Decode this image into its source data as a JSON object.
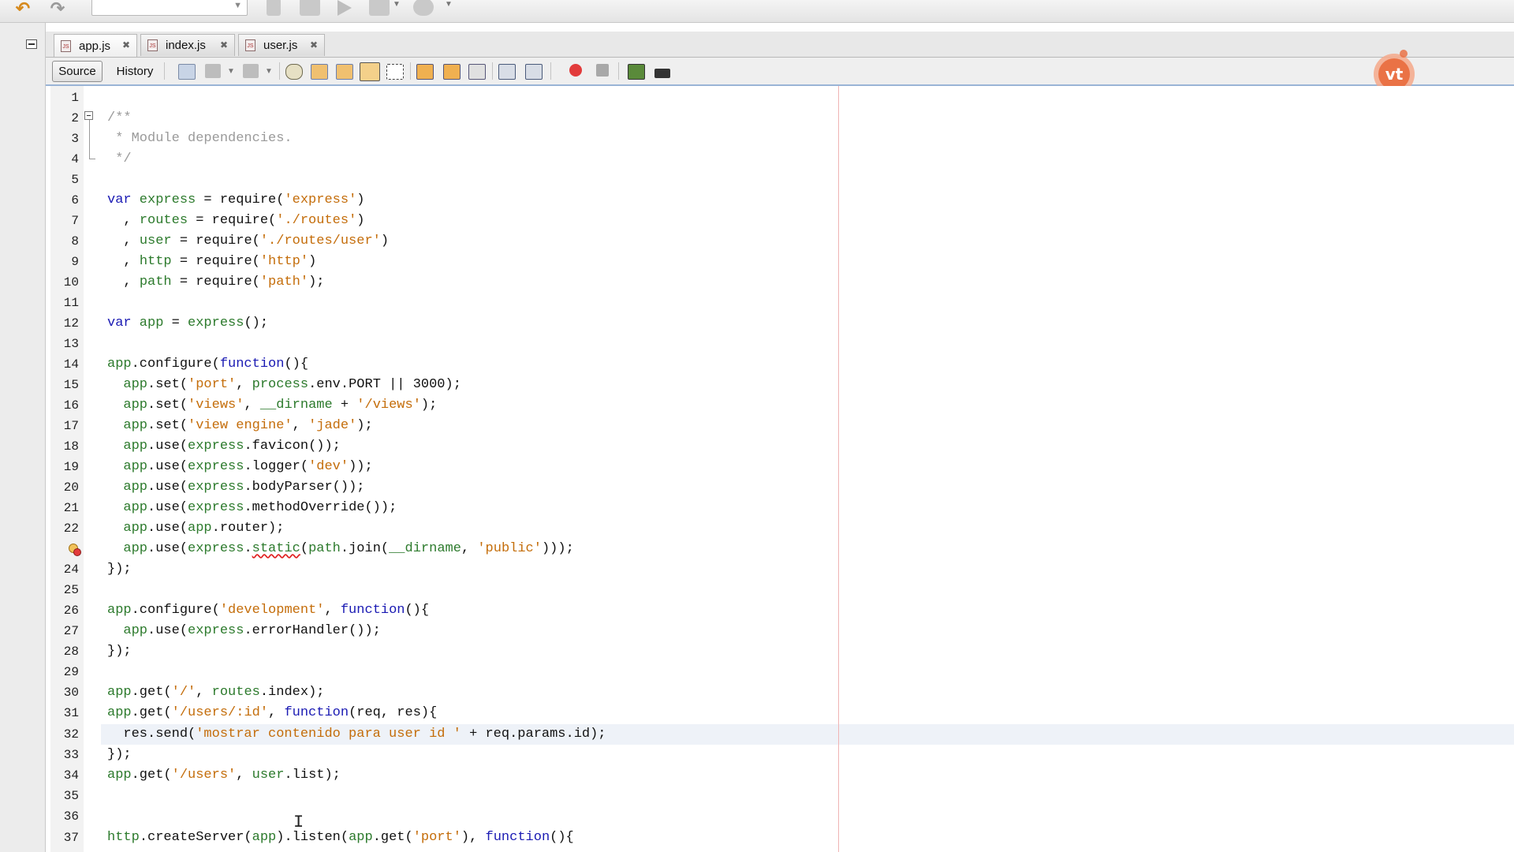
{
  "tabs": [
    {
      "label": "app.js",
      "active": true
    },
    {
      "label": "index.js",
      "active": false
    },
    {
      "label": "user.js",
      "active": false
    }
  ],
  "editor_toolbar": {
    "source_label": "Source",
    "history_label": "History"
  },
  "line_numbers": [
    "1",
    "2",
    "3",
    "4",
    "5",
    "6",
    "7",
    "8",
    "9",
    "10",
    "11",
    "12",
    "13",
    "14",
    "15",
    "16",
    "17",
    "18",
    "19",
    "20",
    "21",
    "22",
    "",
    "24",
    "25",
    "26",
    "27",
    "28",
    "29",
    "30",
    "31",
    "32",
    "33",
    "34",
    "35",
    "36",
    "37"
  ],
  "code": {
    "l2": "/**",
    "l3": " * Module dependencies.",
    "l4": " */",
    "l6a": "var",
    "l6b": " express",
    "l6c": " = require(",
    "l6d": "'express'",
    "l6e": ")",
    "l7a": "  , ",
    "l7b": "routes",
    "l7c": " = require(",
    "l7d": "'./routes'",
    "l7e": ")",
    "l8a": "  , ",
    "l8b": "user",
    "l8c": " = require(",
    "l8d": "'./routes/user'",
    "l8e": ")",
    "l9a": "  , ",
    "l9b": "http",
    "l9c": " = require(",
    "l9d": "'http'",
    "l9e": ")",
    "l10a": "  , ",
    "l10b": "path",
    "l10c": " = require(",
    "l10d": "'path'",
    "l10e": ");",
    "l12a": "var",
    "l12b": " app",
    "l12c": " = ",
    "l12d": "express",
    "l12e": "();",
    "l14a": "app",
    "l14b": ".configure(",
    "l14c": "function",
    "l14d": "(){",
    "l15a": "  app",
    "l15b": ".set(",
    "l15c": "'port'",
    "l15d": ", ",
    "l15e": "process",
    "l15f": ".env.PORT || 3000);",
    "l16a": "  app",
    "l16b": ".set(",
    "l16c": "'views'",
    "l16d": ", ",
    "l16e": "__dirname",
    "l16f": " + ",
    "l16g": "'/views'",
    "l16h": ");",
    "l17a": "  app",
    "l17b": ".set(",
    "l17c": "'view engine'",
    "l17d": ", ",
    "l17e": "'jade'",
    "l17f": ");",
    "l18a": "  app",
    "l18b": ".use(",
    "l18c": "express",
    "l18d": ".favicon());",
    "l19a": "  app",
    "l19b": ".use(",
    "l19c": "express",
    "l19d": ".logger(",
    "l19e": "'dev'",
    "l19f": "));",
    "l20a": "  app",
    "l20b": ".use(",
    "l20c": "express",
    "l20d": ".bodyParser());",
    "l21a": "  app",
    "l21b": ".use(",
    "l21c": "express",
    "l21d": ".methodOverride());",
    "l22a": "  app",
    "l22b": ".use(",
    "l22c": "app",
    "l22d": ".router);",
    "l23a": "  app",
    "l23b": ".use(",
    "l23c": "express",
    "l23d": ".",
    "l23e": "static",
    "l23f": "(",
    "l23g": "path",
    "l23h": ".join(",
    "l23i": "__dirname",
    "l23j": ", ",
    "l23k": "'public'",
    "l23l": ")));",
    "l24": "});",
    "l26a": "app",
    "l26b": ".configure(",
    "l26c": "'development'",
    "l26d": ", ",
    "l26e": "function",
    "l26f": "(){",
    "l27a": "  app",
    "l27b": ".use(",
    "l27c": "express",
    "l27d": ".errorHandler());",
    "l28": "});",
    "l30a": "app",
    "l30b": ".get(",
    "l30c": "'/'",
    "l30d": ", ",
    "l30e": "routes",
    "l30f": ".index);",
    "l31a": "app",
    "l31b": ".get(",
    "l31c": "'/users/:id'",
    "l31d": ", ",
    "l31e": "function",
    "l31f": "(req, res){",
    "l32a": "  res.send(",
    "l32b": "'mostrar contenido para user id '",
    "l32c": " + req.params.id);",
    "l33": "});",
    "l34a": "app",
    "l34b": ".get(",
    "l34c": "'/users'",
    "l34d": ", ",
    "l34e": "user",
    "l34f": ".list);",
    "l37a": "http",
    "l37b": ".createServer(",
    "l37c": "app",
    "l37d": ").listen(",
    "l37e": "app",
    "l37f": ".get(",
    "l37g": "'port'",
    "l37h": "), ",
    "l37i": "function",
    "l37j": "(){"
  },
  "icons": {
    "undo": "undo-icon",
    "redo": "redo-icon",
    "breakpoint": "breakpoint-error-icon",
    "logo": "vt-logo"
  },
  "colors": {
    "keyword": "#1a1ab3",
    "string": "#c46d0a",
    "identifier": "#2c7a2c",
    "comment": "#9a9a9a",
    "margin": "#f0b4b4"
  }
}
